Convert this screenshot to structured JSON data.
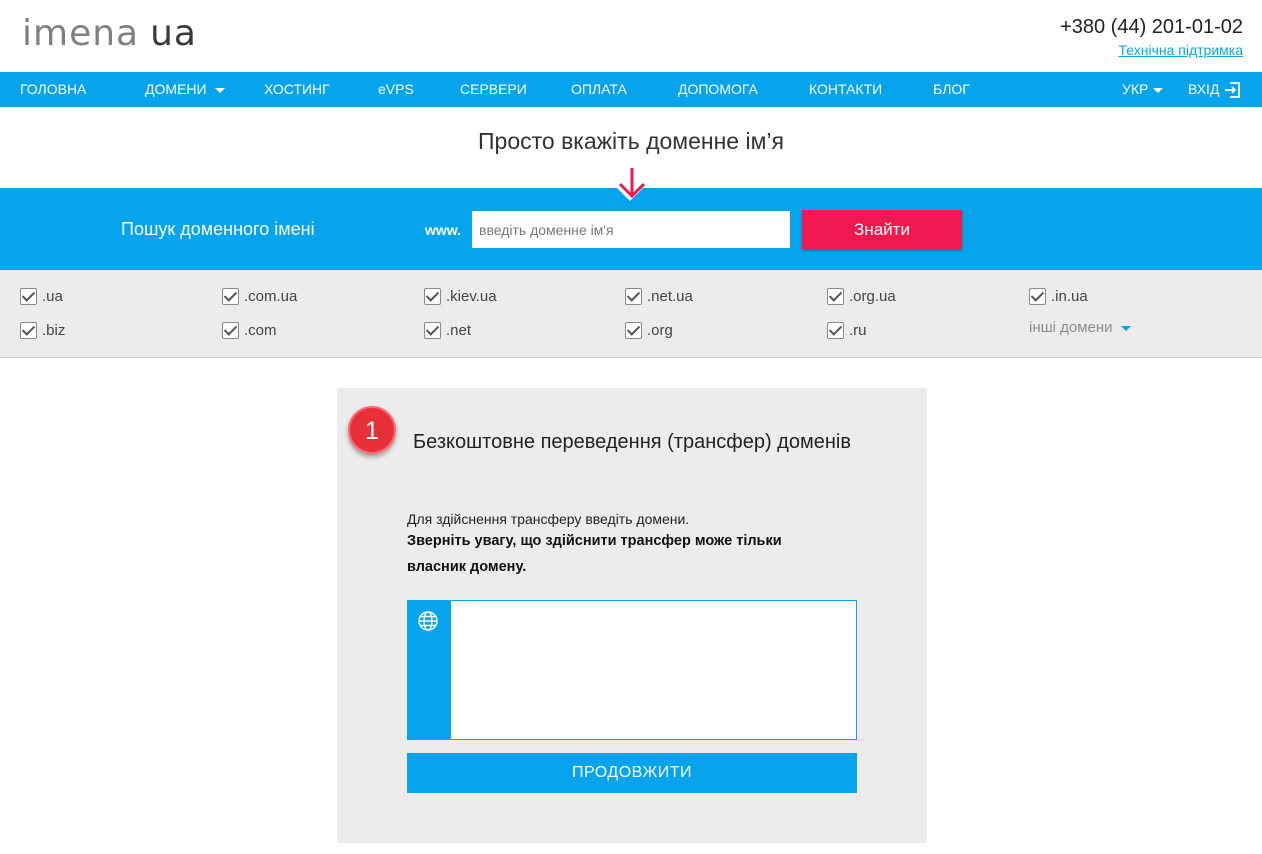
{
  "header": {
    "logo_main": "imena",
    "logo_tld": "ua",
    "phone": "+380 (44) 201-01-02",
    "support_link": "Технічна підтримка"
  },
  "nav": {
    "items": [
      "ГОЛОВНА",
      "ДОМЕНИ",
      "ХОСТИНГ",
      "eVPS",
      "СЕРВЕРИ",
      "ОПЛАТА",
      "ДОПОМОГА",
      "КОНТАКТИ",
      "БЛОГ"
    ],
    "language": "УКР",
    "login": "ВХІД"
  },
  "slogan": "Просто вкажіть доменне ім’я",
  "search": {
    "label": "Пошук доменного імені",
    "prefix": "www.",
    "placeholder": "введіть доменне ім'я",
    "button": "Знайти"
  },
  "tlds": {
    "row1": [
      ".ua",
      ".com.ua",
      ".kiev.ua",
      ".net.ua",
      ".org.ua",
      ".in.ua"
    ],
    "row2": [
      ".biz",
      ".com",
      ".net",
      ".org",
      ".ru"
    ],
    "other": "інші домени"
  },
  "transfer": {
    "step": "1",
    "title": "Безкоштовне переведення (трансфер) доменів",
    "description": "Для здійснення трансферу введіть домени.",
    "warning": "Зверніть увагу, що здійснити трансфер може тільки власник домену.",
    "textarea_value": "",
    "continue_button": "ПРОДОВЖИТИ"
  },
  "colors": {
    "accent": "#05a4ec",
    "find_button": "#f0194f",
    "badge": "#e8303b",
    "panel_bg": "#ececec"
  },
  "icons": {
    "logo_dot": "dot-icon",
    "arrow": "arrow-down-icon",
    "login": "sign-in-icon",
    "textarea": "globe-icon",
    "checkbox": "checkmark-icon"
  }
}
